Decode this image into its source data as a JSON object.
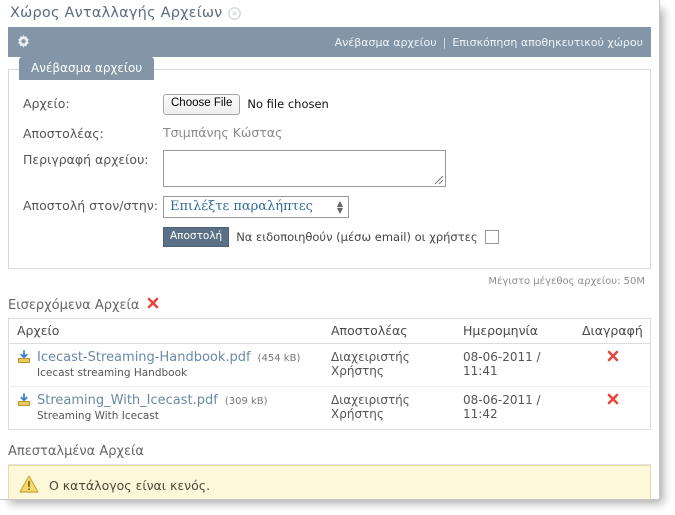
{
  "page": {
    "title": "Χώρος Ανταλλαγής Αρχείων",
    "title_icon": "settings-circle-icon"
  },
  "toolbar": {
    "gear_icon": "gear-icon",
    "links": [
      {
        "label": "Ανέβασμα αρχείου"
      },
      {
        "label": "Επισκόπηση αποθηκευτικού χώρου"
      }
    ],
    "separator": "|",
    "bg_color": "#8296a8"
  },
  "upload_panel": {
    "tab_label": "Ανέβασμα αρχείου",
    "fields": {
      "file": {
        "label": "Αρχείο:",
        "button_label": "Choose File",
        "status": "No file chosen"
      },
      "sender": {
        "label": "Αποστολέας:",
        "value": "Τσιμπάνης Κώστας"
      },
      "description": {
        "label": "Περιγραφή αρχείου:",
        "value": "",
        "placeholder": ""
      },
      "recipients": {
        "label": "Αποστολή στον/στην:",
        "selected": "Επιλέξτε παραλήπτες"
      }
    },
    "submit_label": "Αποστολή",
    "notify_label": "Να ειδοποιηθούν (μέσω email) οι χρήστες",
    "notify_checked": false
  },
  "max_size_note": "Μέγιστο μέγεθος αρχείου: 50M",
  "incoming": {
    "heading": "Εισερχόμενα Αρχεία",
    "heading_delete_icon": "delete-x-icon",
    "columns": [
      "Αρχείο",
      "Αποστολέας",
      "Ημερομηνία",
      "Διαγραφή"
    ],
    "rows": [
      {
        "icon": "download-file-icon",
        "name": "Icecast-Streaming-Handbook.pdf",
        "size": "(454 kB)",
        "description": "Icecast streaming Handbook",
        "sender": "Διαχειριστής Χρήστης",
        "date": "08-06-2011 / 11:41",
        "delete_icon": "delete-x-icon"
      },
      {
        "icon": "download-file-icon",
        "name": "Streaming_With_Icecast.pdf",
        "size": "(309 kB)",
        "description": "Streaming With Icecast",
        "sender": "Διαχειριστής Χρήστης",
        "date": "08-06-2011 / 11:42",
        "delete_icon": "delete-x-icon"
      }
    ]
  },
  "sent": {
    "heading": "Απεσταλμένα Αρχεία",
    "empty_message": "Ο κατάλογος είναι κενός.",
    "warning_icon": "warning-triangle-icon"
  },
  "colors": {
    "toolbar": "#8296a8",
    "title_text": "#5a6b80",
    "link": "#6a89a8",
    "danger": "#e8453c",
    "warning_bg": "#fcf8d9"
  }
}
